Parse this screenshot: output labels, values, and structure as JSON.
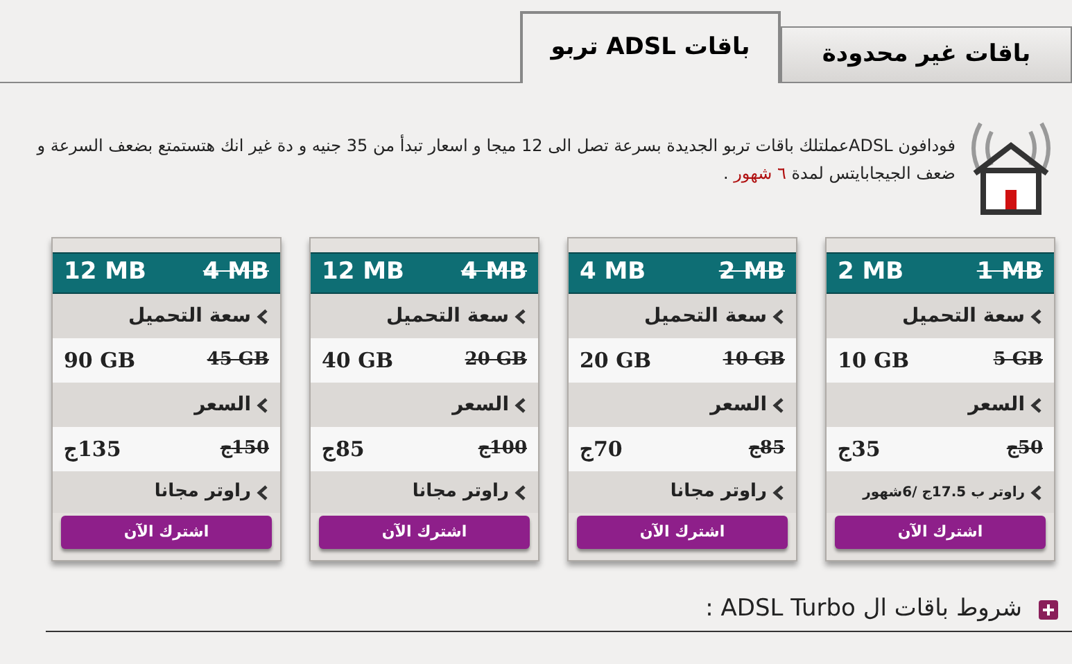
{
  "tabs": [
    {
      "label": "باقات غير محدودة",
      "selected": false
    },
    {
      "label": "باقات ADSL تربو",
      "selected": true
    }
  ],
  "intro": {
    "text_before": "فودافون ADSLعملتلك باقات تربو الجديدة بسرعة تصل الى 12 ميجا و اسعار تبدأ من 35 جنيه و دة غير انك هتستمتع بضعف السرعة و ضعف الجيجابايتس لمدة ",
    "highlight": "٦ شهور",
    "text_after": " ."
  },
  "plans": [
    {
      "speed_old": "1 MB",
      "speed_new": "2 MB",
      "capacity_label": "سعة التحميل",
      "capacity_old": "5 GB",
      "capacity_new": "10 GB",
      "price_label": "السعر",
      "price_old": "50ج",
      "price_new": "35ج",
      "router": "راوتر ب 17.5ج /6شهور",
      "button": "اشترك الآن"
    },
    {
      "speed_old": "2 MB",
      "speed_new": "4 MB",
      "capacity_label": "سعة التحميل",
      "capacity_old": "10 GB",
      "capacity_new": "20 GB",
      "price_label": "السعر",
      "price_old": "85ج",
      "price_new": "70ج",
      "router": "راوتر مجانا",
      "button": "اشترك الآن"
    },
    {
      "speed_old": "4 MB",
      "speed_new": "12 MB",
      "capacity_label": "سعة التحميل",
      "capacity_old": "20 GB",
      "capacity_new": "40 GB",
      "price_label": "السعر",
      "price_old": "100ج",
      "price_new": "85ج",
      "router": "راوتر مجانا",
      "button": "اشترك الآن"
    },
    {
      "speed_old": "4 MB",
      "speed_new": "12 MB",
      "capacity_label": "سعة التحميل",
      "capacity_old": "45 GB",
      "capacity_new": "90 GB",
      "price_label": "السعر",
      "price_old": "150ج",
      "price_new": "135ج",
      "router": "راوتر مجانا",
      "button": "اشترك الآن"
    }
  ],
  "terms": {
    "label": "شروط باقات ال ADSL Turbo :",
    "expanded": false
  }
}
